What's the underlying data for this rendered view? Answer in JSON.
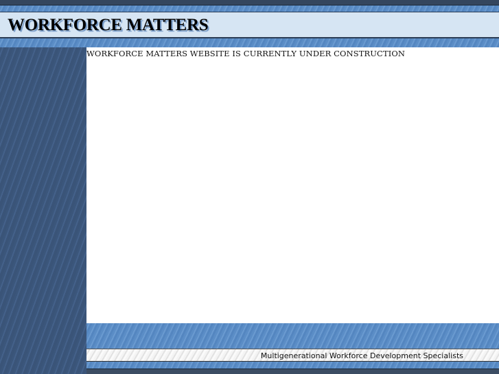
{
  "header": {
    "logo_text": "WORKFORCE MATTERS"
  },
  "main": {
    "message": "WORKFORCE MATTERS WEBSITE IS CURRENTLY UNDER CONSTRUCTION"
  },
  "footer": {
    "tagline": "Multigenerational Workforce Development Specialists"
  }
}
